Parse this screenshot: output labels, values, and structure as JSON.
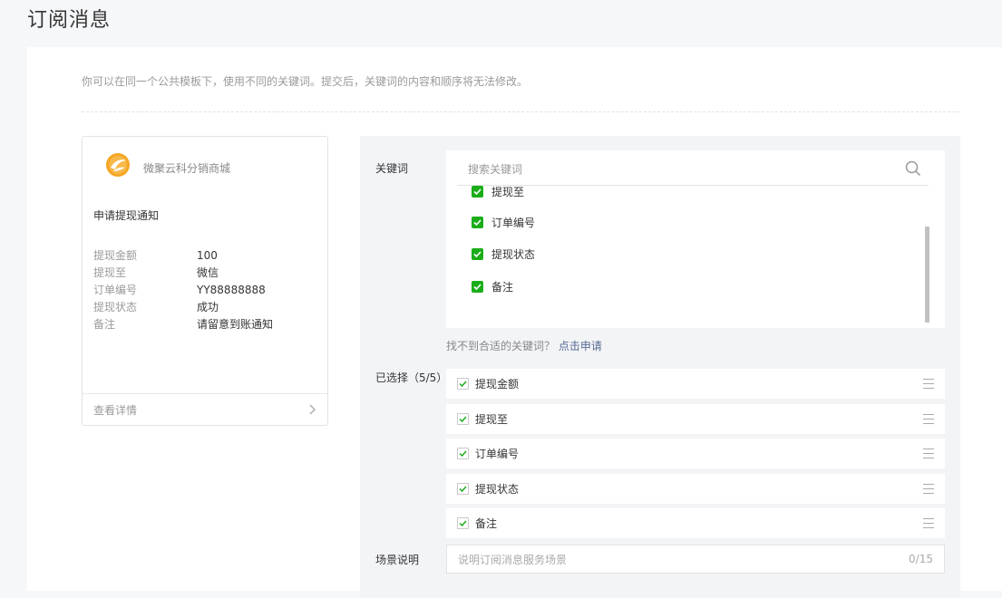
{
  "page": {
    "title": "订阅消息"
  },
  "tip": "你可以在同一个公共模板下，使用不同的关键词。提交后，关键词的内容和顺序将无法修改。",
  "preview": {
    "app_name": "微聚云科分销商城",
    "template_title": "申请提现通知",
    "rows": [
      {
        "key": "提现金额",
        "value": "100"
      },
      {
        "key": "提现至",
        "value": "微信"
      },
      {
        "key": "订单编号",
        "value": "YY88888888"
      },
      {
        "key": "提现状态",
        "value": "成功"
      },
      {
        "key": "备注",
        "value": "请留意到账通知"
      }
    ],
    "footer_label": "查看详情",
    "logo_colors": {
      "outer": "#f5a623",
      "inner": "#ffffff"
    }
  },
  "keywords": {
    "label": "关键词",
    "search_placeholder": "搜索关键词",
    "items": [
      "提现至",
      "订单编号",
      "提现状态",
      "备注"
    ],
    "help_text": "找不到合适的关键词？",
    "help_link": "点击申请",
    "check_color": "#1aad19"
  },
  "selected": {
    "label": "已选择（5/5）",
    "items": [
      "提现金额",
      "提现至",
      "订单编号",
      "提现状态",
      "备注"
    ]
  },
  "scene": {
    "label": "场景说明",
    "placeholder": "说明订阅消息服务场景",
    "counter": "0/15"
  }
}
